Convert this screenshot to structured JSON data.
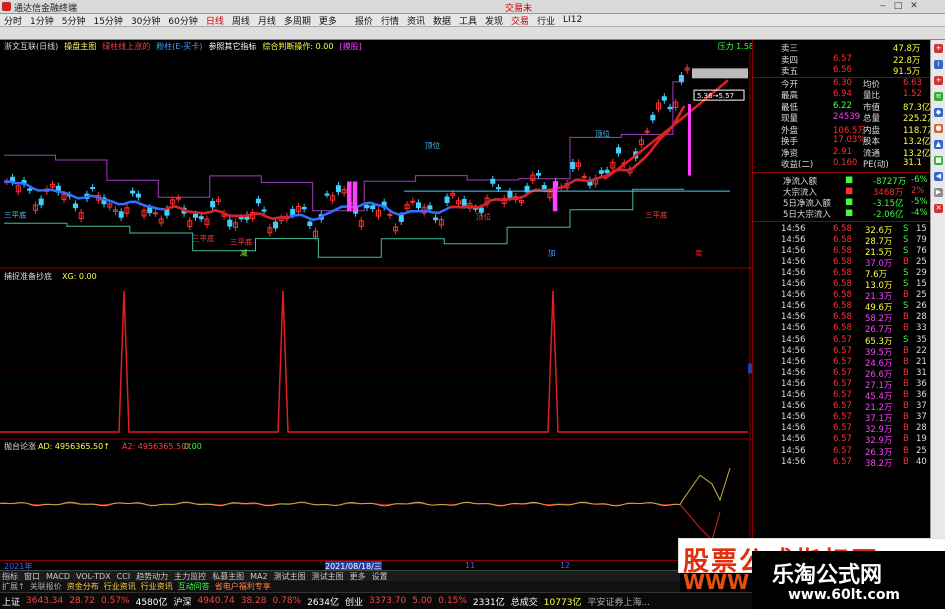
{
  "window": {
    "title": "通达信金融终端",
    "right_text": "交易未"
  },
  "menu": {
    "items": [
      "分时",
      "1分钟",
      "5分钟",
      "15分钟",
      "30分钟",
      "60分钟",
      "日线",
      "周线",
      "月线",
      "多周期",
      "更多"
    ],
    "active": 6
  },
  "toolbar": {
    "items": [
      "报价",
      "行情",
      "资讯",
      "数据",
      "工具",
      "发现",
      "交易",
      "行业",
      "LI12"
    ]
  },
  "info": {
    "stock": "浙文互联(日线)",
    "i1": "操盘主图",
    "i2": "绿柱线上涨的",
    "i3": "粉柱(E-买卡)",
    "i4": "参照其它指标",
    "i5": "综合判断操作: 0.00",
    "i6": "[摸股]",
    "i7": "压力 1.58"
  },
  "main_chart": {
    "yticks": [
      "5.50",
      "5.25",
      "5.00",
      "4.75",
      "4.50",
      "4.25",
      "4.00"
    ],
    "price_box": "5.36→5.57",
    "labels": [
      {
        "text": "三平底",
        "color": "#40c0ff"
      },
      {
        "text": "三平底",
        "color": "#ff4040"
      },
      {
        "text": "三平底",
        "color": "#ff4040"
      },
      {
        "text": "顶位",
        "color": "#40c0ff"
      },
      {
        "text": "顶位",
        "color": "#ff4040"
      },
      {
        "text": "三平底",
        "color": "#ff4040"
      },
      {
        "text": "顶位",
        "color": "#40c0ff"
      },
      {
        "text": "减",
        "color": "#80ff40"
      },
      {
        "text": "加",
        "color": "#40a0ff"
      },
      {
        "text": "卖",
        "color": "#ff2020"
      }
    ]
  },
  "sub1": {
    "title": "捕捉准备抄底",
    "value": "XG: 0.00",
    "yticks": [
      "1.00",
      "0.80",
      "0.60",
      "0.45",
      "0.40",
      "0.20"
    ]
  },
  "sub2": {
    "title": "抛台论涨",
    "value": "AD: 4956365.50↑",
    "value2": "A2: 4956365.50↑",
    "value3": "0.00",
    "yticks": [
      "50000",
      "25000",
      "0",
      "-25000"
    ]
  },
  "time_axis": {
    "t1": "2021年",
    "t2": "2021/08/18/三",
    "t3": "11",
    "t4": "12"
  },
  "quote": {
    "rows": [
      {
        "label": "卖三",
        "price": "",
        "vol": "47.8万"
      },
      {
        "label": "卖四",
        "price": "6.57",
        "vol": "22.8万"
      },
      {
        "label": "卖五",
        "price": "6.56",
        "vol": "91.5万"
      },
      {
        "label": "今开",
        "price": "6.30",
        "label2": "均价",
        "val2": "6.63"
      },
      {
        "label": "最高",
        "price": "6.94",
        "label2": "量比",
        "val2": "1.52"
      },
      {
        "label": "最低",
        "price": "6.22",
        "label2": "市值",
        "val2": "87.3亿"
      },
      {
        "label": "现量",
        "price": "24539",
        "label2": "总量",
        "val2": "225.2万"
      },
      {
        "label": "外盘",
        "price": "106.5万",
        "label2": "内盘",
        "val2": "118.7万"
      },
      {
        "label": "换手",
        "price": "17.03%",
        "label2": "股本",
        "val2": "13.2亿"
      },
      {
        "label": "净资",
        "price": "2.91",
        "label2": "流通",
        "val2": "13.2亿"
      },
      {
        "label": "收益(二)",
        "price": "0.160",
        "label2": "PE(动)",
        "val2": "31.1"
      }
    ],
    "flow": [
      {
        "label": "净流入额",
        "val": "-8727万",
        "pct": "-6%"
      },
      {
        "label": "大宗流入",
        "val": "3468万",
        "pct": "2%"
      },
      {
        "label": "5日净流入额",
        "val": "-3.15亿",
        "pct": "-5%"
      },
      {
        "label": "5日大宗流入",
        "val": "-2.06亿",
        "pct": "-4%"
      }
    ],
    "ticks": [
      {
        "t": "14:56",
        "p": "6.58",
        "v": "32.6万",
        "s": "S",
        "n": "15"
      },
      {
        "t": "14:56",
        "p": "6.58",
        "v": "28.7万",
        "s": "S",
        "n": "79"
      },
      {
        "t": "14:56",
        "p": "6.58",
        "v": "21.5万",
        "s": "S",
        "n": "76"
      },
      {
        "t": "14:56",
        "p": "6.58",
        "v": "37.0万",
        "s": "B",
        "n": "25"
      },
      {
        "t": "14:56",
        "p": "6.58",
        "v": "7.6万",
        "s": "S",
        "n": "29"
      },
      {
        "t": "14:56",
        "p": "6.58",
        "v": "13.0万",
        "s": "S",
        "n": "15"
      },
      {
        "t": "14:56",
        "p": "6.58",
        "v": "21.3万",
        "s": "B",
        "n": "25"
      },
      {
        "t": "14:56",
        "p": "6.58",
        "v": "49.6万",
        "s": "S",
        "n": "26"
      },
      {
        "t": "14:56",
        "p": "6.58",
        "v": "58.2万",
        "s": "B",
        "n": "28"
      },
      {
        "t": "14:56",
        "p": "6.58",
        "v": "26.7万",
        "s": "B",
        "n": "33"
      },
      {
        "t": "14:56",
        "p": "6.57",
        "v": "65.3万",
        "s": "S",
        "n": "35"
      },
      {
        "t": "14:56",
        "p": "6.57",
        "v": "39.5万",
        "s": "B",
        "n": "22"
      },
      {
        "t": "14:56",
        "p": "6.57",
        "v": "24.6万",
        "s": "B",
        "n": "21"
      },
      {
        "t": "14:56",
        "p": "6.57",
        "v": "26.6万",
        "s": "B",
        "n": "31"
      },
      {
        "t": "14:56",
        "p": "6.57",
        "v": "27.1万",
        "s": "B",
        "n": "36"
      },
      {
        "t": "14:56",
        "p": "6.57",
        "v": "45.4万",
        "s": "B",
        "n": "36"
      },
      {
        "t": "14:56",
        "p": "6.57",
        "v": "21.2万",
        "s": "B",
        "n": "37"
      },
      {
        "t": "14:56",
        "p": "6.57",
        "v": "37.1万",
        "s": "B",
        "n": "37"
      },
      {
        "t": "14:56",
        "p": "6.57",
        "v": "32.9万",
        "s": "B",
        "n": "28"
      },
      {
        "t": "14:56",
        "p": "6.57",
        "v": "32.9万",
        "s": "B",
        "n": "19"
      },
      {
        "t": "14:56",
        "p": "6.57",
        "v": "26.3万",
        "s": "B",
        "n": "25"
      },
      {
        "t": "14:56",
        "p": "6.57",
        "v": "38.2万",
        "s": "B",
        "n": "40"
      }
    ]
  },
  "tabs": {
    "row1": [
      "指标",
      "窗口",
      "MACD",
      "VOL-TDX",
      "CCI",
      "趋势动力",
      "主力监控",
      "私募主图",
      "MA2",
      "测试主图",
      "测试主图",
      "更多",
      "设置"
    ],
    "row2": [
      "扩展↑",
      "关联报价",
      "资金分布",
      "行业资讯",
      "行业资讯",
      "互动问答",
      "省电户福利专享"
    ]
  },
  "status": {
    "sh_label": "上证",
    "sh_val": "3643.34",
    "sh_chg": "28.72",
    "sh_pct": "0.57%",
    "sh_amt": "4580亿",
    "sz_label": "沪深",
    "sz_val": "4940.74",
    "sz_chg": "38.28",
    "sz_pct": "0.78%",
    "sz_amt": "2634亿",
    "cy_label": "创业",
    "cy_val": "3373.70",
    "cy_chg": "5.00",
    "cy_pct": "0.15%",
    "cy_amt": "2331亿",
    "tot_label": "总成交",
    "tot_val": "10773亿",
    "tot_extra": "平安证券上海..."
  },
  "watermark": {
    "big": "股票公式指标网",
    "small": "WWW",
    "site": "乐淘公式网",
    "url": "www.60lt.com"
  },
  "colors": {
    "up": "#ff3030",
    "down": "#40d0ff",
    "bg": "#000000",
    "axis": "#8a0000",
    "yellow": "#ffff00",
    "green": "#40ff40",
    "magenta": "#ff40ff"
  }
}
